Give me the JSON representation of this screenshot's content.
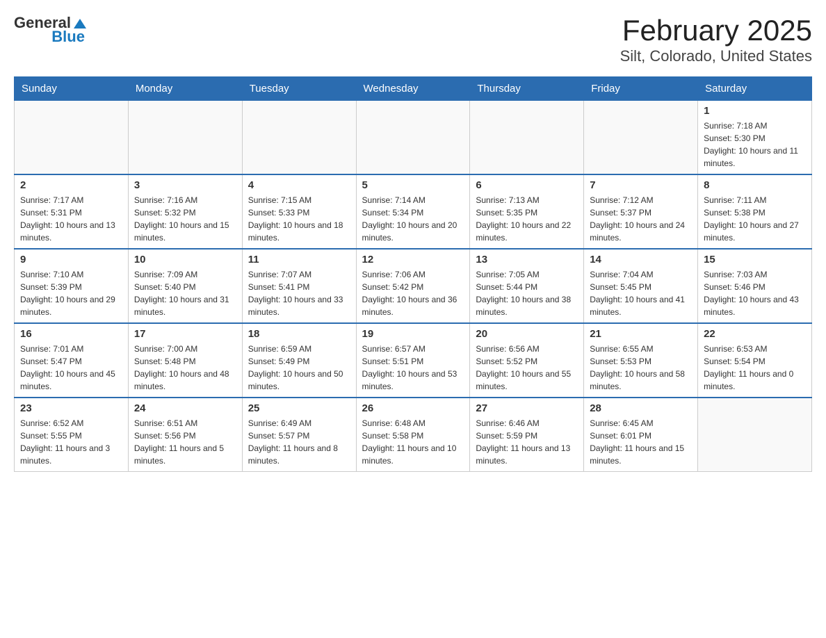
{
  "header": {
    "logo_general": "General",
    "logo_blue": "Blue",
    "month_title": "February 2025",
    "location": "Silt, Colorado, United States"
  },
  "days_of_week": [
    "Sunday",
    "Monday",
    "Tuesday",
    "Wednesday",
    "Thursday",
    "Friday",
    "Saturday"
  ],
  "weeks": [
    [
      {
        "day": "",
        "info": ""
      },
      {
        "day": "",
        "info": ""
      },
      {
        "day": "",
        "info": ""
      },
      {
        "day": "",
        "info": ""
      },
      {
        "day": "",
        "info": ""
      },
      {
        "day": "",
        "info": ""
      },
      {
        "day": "1",
        "info": "Sunrise: 7:18 AM\nSunset: 5:30 PM\nDaylight: 10 hours and 11 minutes."
      }
    ],
    [
      {
        "day": "2",
        "info": "Sunrise: 7:17 AM\nSunset: 5:31 PM\nDaylight: 10 hours and 13 minutes."
      },
      {
        "day": "3",
        "info": "Sunrise: 7:16 AM\nSunset: 5:32 PM\nDaylight: 10 hours and 15 minutes."
      },
      {
        "day": "4",
        "info": "Sunrise: 7:15 AM\nSunset: 5:33 PM\nDaylight: 10 hours and 18 minutes."
      },
      {
        "day": "5",
        "info": "Sunrise: 7:14 AM\nSunset: 5:34 PM\nDaylight: 10 hours and 20 minutes."
      },
      {
        "day": "6",
        "info": "Sunrise: 7:13 AM\nSunset: 5:35 PM\nDaylight: 10 hours and 22 minutes."
      },
      {
        "day": "7",
        "info": "Sunrise: 7:12 AM\nSunset: 5:37 PM\nDaylight: 10 hours and 24 minutes."
      },
      {
        "day": "8",
        "info": "Sunrise: 7:11 AM\nSunset: 5:38 PM\nDaylight: 10 hours and 27 minutes."
      }
    ],
    [
      {
        "day": "9",
        "info": "Sunrise: 7:10 AM\nSunset: 5:39 PM\nDaylight: 10 hours and 29 minutes."
      },
      {
        "day": "10",
        "info": "Sunrise: 7:09 AM\nSunset: 5:40 PM\nDaylight: 10 hours and 31 minutes."
      },
      {
        "day": "11",
        "info": "Sunrise: 7:07 AM\nSunset: 5:41 PM\nDaylight: 10 hours and 33 minutes."
      },
      {
        "day": "12",
        "info": "Sunrise: 7:06 AM\nSunset: 5:42 PM\nDaylight: 10 hours and 36 minutes."
      },
      {
        "day": "13",
        "info": "Sunrise: 7:05 AM\nSunset: 5:44 PM\nDaylight: 10 hours and 38 minutes."
      },
      {
        "day": "14",
        "info": "Sunrise: 7:04 AM\nSunset: 5:45 PM\nDaylight: 10 hours and 41 minutes."
      },
      {
        "day": "15",
        "info": "Sunrise: 7:03 AM\nSunset: 5:46 PM\nDaylight: 10 hours and 43 minutes."
      }
    ],
    [
      {
        "day": "16",
        "info": "Sunrise: 7:01 AM\nSunset: 5:47 PM\nDaylight: 10 hours and 45 minutes."
      },
      {
        "day": "17",
        "info": "Sunrise: 7:00 AM\nSunset: 5:48 PM\nDaylight: 10 hours and 48 minutes."
      },
      {
        "day": "18",
        "info": "Sunrise: 6:59 AM\nSunset: 5:49 PM\nDaylight: 10 hours and 50 minutes."
      },
      {
        "day": "19",
        "info": "Sunrise: 6:57 AM\nSunset: 5:51 PM\nDaylight: 10 hours and 53 minutes."
      },
      {
        "day": "20",
        "info": "Sunrise: 6:56 AM\nSunset: 5:52 PM\nDaylight: 10 hours and 55 minutes."
      },
      {
        "day": "21",
        "info": "Sunrise: 6:55 AM\nSunset: 5:53 PM\nDaylight: 10 hours and 58 minutes."
      },
      {
        "day": "22",
        "info": "Sunrise: 6:53 AM\nSunset: 5:54 PM\nDaylight: 11 hours and 0 minutes."
      }
    ],
    [
      {
        "day": "23",
        "info": "Sunrise: 6:52 AM\nSunset: 5:55 PM\nDaylight: 11 hours and 3 minutes."
      },
      {
        "day": "24",
        "info": "Sunrise: 6:51 AM\nSunset: 5:56 PM\nDaylight: 11 hours and 5 minutes."
      },
      {
        "day": "25",
        "info": "Sunrise: 6:49 AM\nSunset: 5:57 PM\nDaylight: 11 hours and 8 minutes."
      },
      {
        "day": "26",
        "info": "Sunrise: 6:48 AM\nSunset: 5:58 PM\nDaylight: 11 hours and 10 minutes."
      },
      {
        "day": "27",
        "info": "Sunrise: 6:46 AM\nSunset: 5:59 PM\nDaylight: 11 hours and 13 minutes."
      },
      {
        "day": "28",
        "info": "Sunrise: 6:45 AM\nSunset: 6:01 PM\nDaylight: 11 hours and 15 minutes."
      },
      {
        "day": "",
        "info": ""
      }
    ]
  ]
}
